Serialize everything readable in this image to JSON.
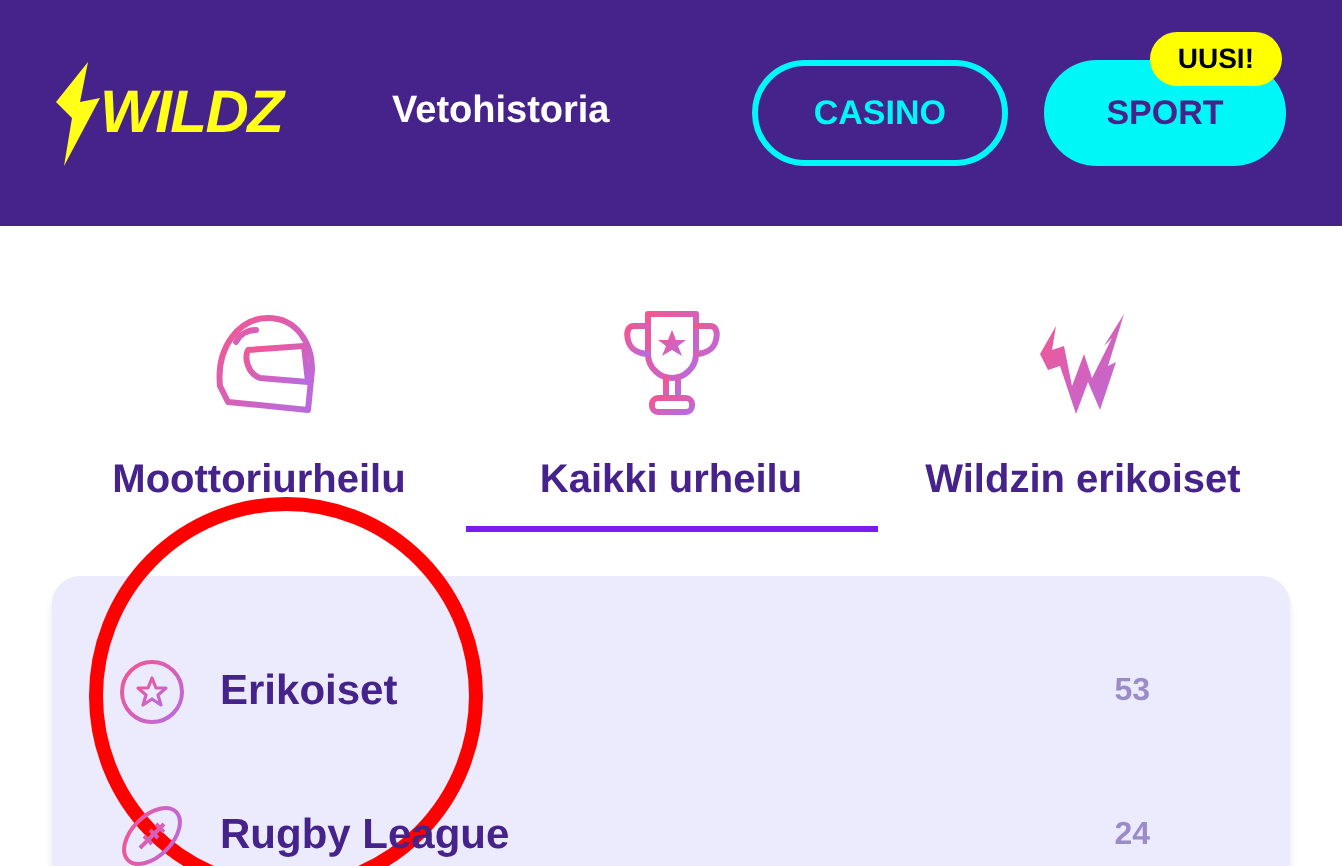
{
  "header": {
    "logo": "WILDZ",
    "nav_link": "Vetohistoria",
    "buttons": [
      {
        "label": "CASINO",
        "selected": false
      },
      {
        "label": "SPORT",
        "selected": true,
        "badge": "UUSI!"
      }
    ]
  },
  "tabs": [
    {
      "label": "Moottoriurheilu",
      "kind": "helmet",
      "selected": false
    },
    {
      "label": "Kaikki urheilu",
      "kind": "trophy",
      "selected": true
    },
    {
      "label": "Wildzin erikoiset",
      "kind": "bolt",
      "selected": false
    }
  ],
  "categories": [
    {
      "name": "Erikoiset",
      "count": "53",
      "kind": "star"
    },
    {
      "name": "Rugby League",
      "count": "24",
      "kind": "rugby"
    }
  ]
}
